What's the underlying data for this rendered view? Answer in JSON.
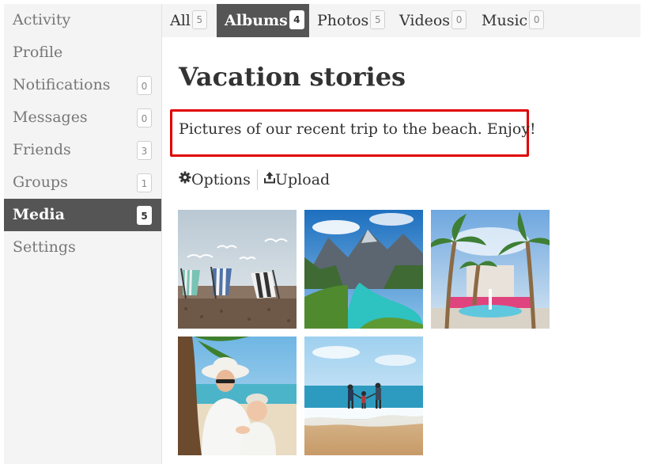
{
  "sidebar": {
    "items": [
      {
        "label": "Activity",
        "badge": ""
      },
      {
        "label": "Profile",
        "badge": ""
      },
      {
        "label": "Notifications",
        "badge": "0"
      },
      {
        "label": "Messages",
        "badge": "0"
      },
      {
        "label": "Friends",
        "badge": "3"
      },
      {
        "label": "Groups",
        "badge": "1"
      },
      {
        "label": "Media",
        "badge": "5",
        "active": true
      },
      {
        "label": "Settings",
        "badge": ""
      }
    ]
  },
  "tabs": [
    {
      "label": "All",
      "count": "5"
    },
    {
      "label": "Albums",
      "count": "4",
      "active": true
    },
    {
      "label": "Photos",
      "count": "5"
    },
    {
      "label": "Videos",
      "count": "0"
    },
    {
      "label": "Music",
      "count": "0"
    }
  ],
  "album": {
    "title": "Vacation stories",
    "description": "Pictures of our recent trip to the beach. Enjoy!"
  },
  "actions": {
    "options_label": "Options",
    "upload_label": "Upload",
    "options_icon": "gear-icon",
    "upload_icon": "upload-icon"
  },
  "photos": [
    {
      "subject": "beach-chairs-seagulls"
    },
    {
      "subject": "turquoise-river-mountains"
    },
    {
      "subject": "palm-trees-fountain"
    },
    {
      "subject": "mother-baby-beach"
    },
    {
      "subject": "family-walking-surf"
    }
  ],
  "colors": {
    "active_bg": "#555555",
    "sidebar_bg": "#f4f4f4",
    "highlight_border": "#e00000"
  }
}
